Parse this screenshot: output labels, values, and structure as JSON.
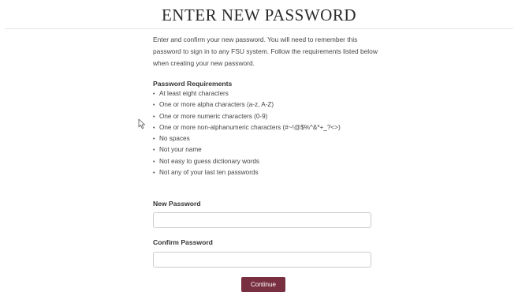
{
  "page": {
    "title": "ENTER NEW PASSWORD"
  },
  "intro": {
    "text": "Enter and confirm your new password. You will need to remember this password to sign in to any FSU system. Follow the requirements listed below when creating your new password."
  },
  "requirements": {
    "heading": "Password Requirements",
    "items": [
      "At least eight characters",
      "One or more alpha characters (a-z, A-Z)",
      "One or more numeric characters (0-9)",
      "One or more non-alphanumeric characters (#~!@$%^&*+_?<>)",
      "No spaces",
      "Not your name",
      "Not easy to guess dictionary words",
      "Not any of your last ten passwords"
    ]
  },
  "form": {
    "new_password_label": "New Password",
    "new_password_value": "",
    "confirm_password_label": "Confirm Password",
    "confirm_password_value": "",
    "continue_label": "Continue"
  },
  "colors": {
    "button_background": "#782f40",
    "button_text": "#ffffff",
    "input_border": "#cccccc"
  },
  "icons": {
    "pointer": "mouse-pointer-icon"
  }
}
